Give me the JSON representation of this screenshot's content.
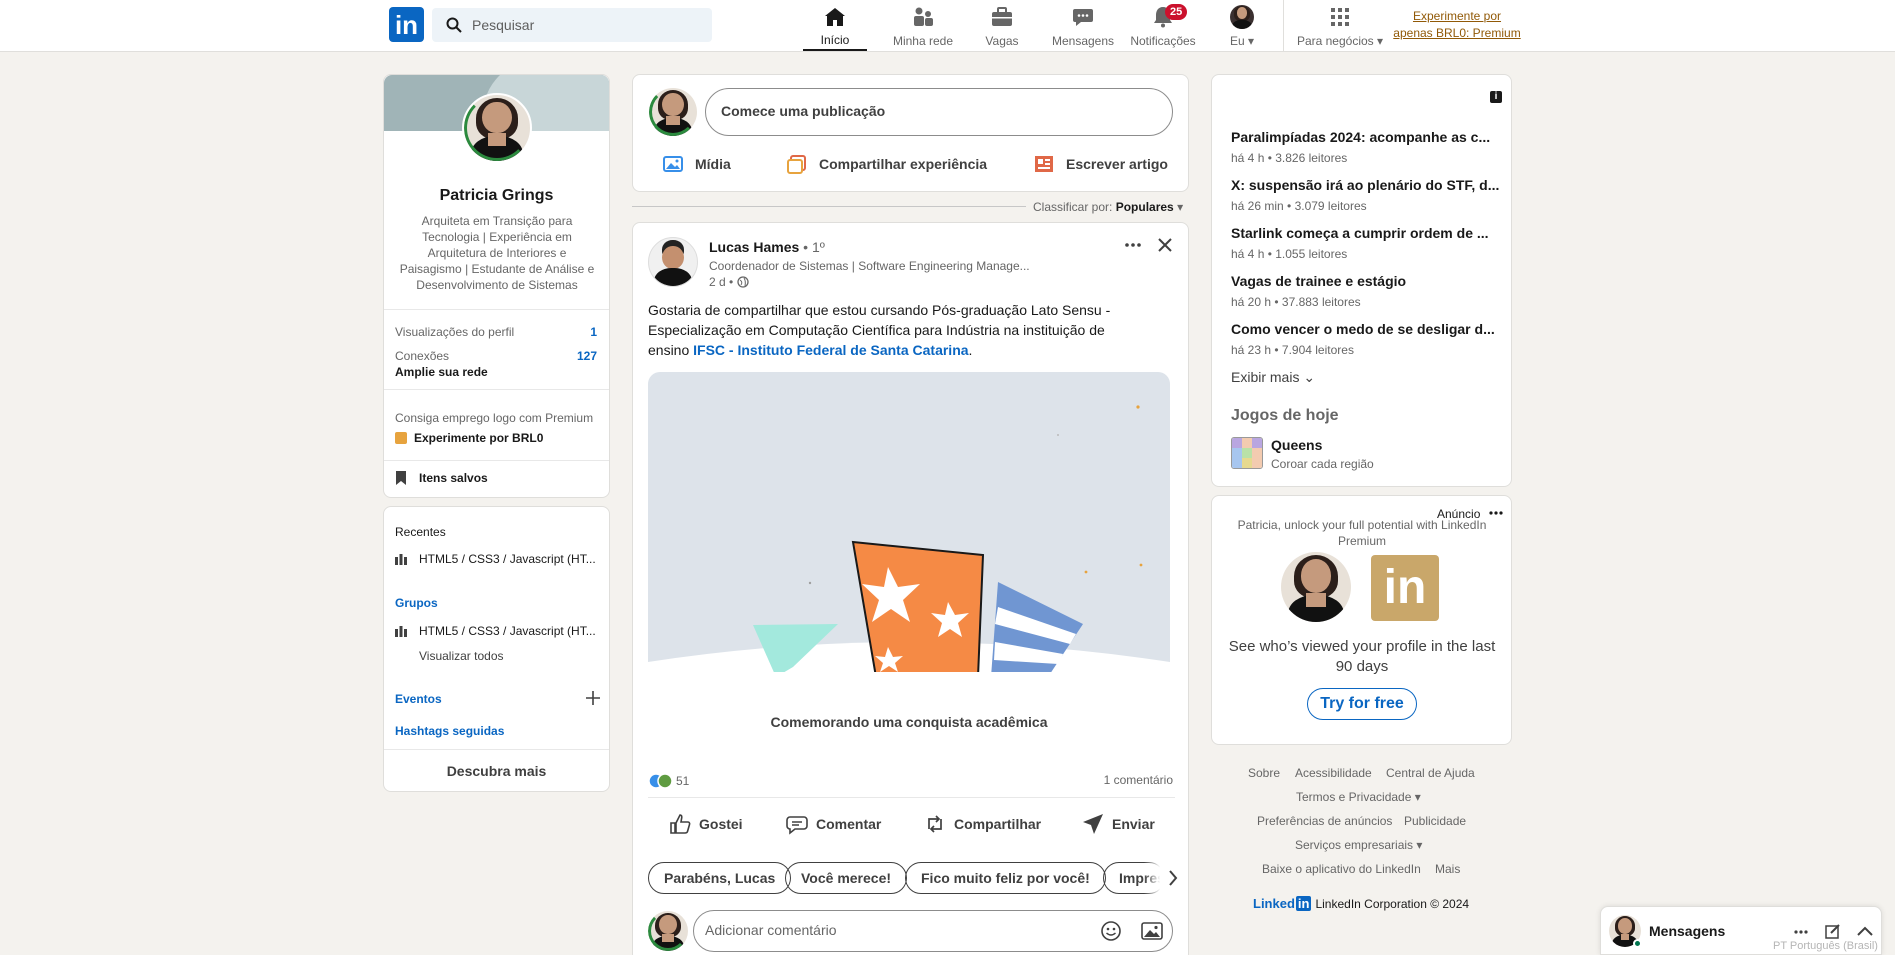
{
  "header": {
    "search_placeholder": "Pesquisar",
    "nav": [
      {
        "label": "Início",
        "icon": "home-icon"
      },
      {
        "label": "Minha rede",
        "icon": "network-icon"
      },
      {
        "label": "Vagas",
        "icon": "briefcase-icon"
      },
      {
        "label": "Mensagens",
        "icon": "messaging-icon"
      },
      {
        "label": "Notificações",
        "icon": "bell-icon",
        "badge": "25"
      },
      {
        "label": "Eu",
        "icon": "avatar"
      },
      {
        "label": "Para negócios",
        "icon": "grid-icon"
      }
    ],
    "premium_cta": "Experimente por apenas BRL0: Premium"
  },
  "profile": {
    "name": "Patricia Grings",
    "headline": "Arquiteta em Transição para Tecnologia | Experiência em Arquitetura de Interiores e Paisagismo | Estudante de Análise e Desenvolvimento de Sistemas",
    "profile_views_label": "Visualizações do perfil",
    "profile_views_value": "1",
    "connections_label": "Conexões",
    "connections_value": "127",
    "grow_network": "Amplie sua rede",
    "premium_teaser": "Consiga emprego logo com Premium",
    "premium_try": "Experimente por BRL0",
    "saved_items": "Itens salvos"
  },
  "left_secondary": {
    "recent_title": "Recentes",
    "recent_item": "HTML5 / CSS3 / Javascript (HT...",
    "groups_title": "Grupos",
    "group_item": "HTML5 / CSS3 / Javascript (HT...",
    "view_all": "Visualizar todos",
    "events": "Eventos",
    "hashtags": "Hashtags seguidas",
    "discover": "Descubra mais"
  },
  "composer": {
    "placeholder": "Comece uma publicação",
    "media": "Mídia",
    "share_experience": "Compartilhar experiência",
    "write_article": "Escrever artigo"
  },
  "sort": {
    "label": "Classificar por:",
    "value": "Populares"
  },
  "post": {
    "author": "Lucas Hames",
    "degree": "• 1º",
    "subtitle": "Coordenador de Sistemas | Software Engineering Manage...",
    "time": "2 d •",
    "text": "Gostaria de compartilhar que estou cursando Pós-graduação Lato Sensu - Especialização em Computação Científica para Indústria na instituição de ensino",
    "link": "IFSC - Instituto Federal de Santa Catarina",
    "link_suffix": ".",
    "caption": "Comemorando uma conquista acadêmica",
    "reactions": "51",
    "comments": "1 comentário",
    "actions": [
      "Gostei",
      "Comentar",
      "Compartilhar",
      "Enviar"
    ],
    "suggestions": [
      "Parabéns, Lucas",
      "Você merece!",
      "Fico muito feliz por você!",
      "Impres"
    ],
    "comment_placeholder": "Adicionar comentário"
  },
  "news": {
    "items": [
      {
        "title": "Paralimpíadas 2024: acompanhe as c...",
        "meta": "há 4 h • 3.826 leitores"
      },
      {
        "title": "X: suspensão irá ao plenário do STF, d...",
        "meta": "há 26 min • 3.079 leitores"
      },
      {
        "title": "Starlink começa a cumprir ordem de ...",
        "meta": "há 4 h • 1.055 leitores"
      },
      {
        "title": "Vagas de trainee e estágio",
        "meta": "há 20 h • 37.883 leitores"
      },
      {
        "title": "Como vencer o medo de se desligar d...",
        "meta": "há 23 h • 7.904 leitores"
      }
    ],
    "show_more": "Exibir mais",
    "games_title": "Jogos de hoje",
    "game_name": "Queens",
    "game_desc": "Coroar cada região"
  },
  "ad": {
    "label": "Anúncio",
    "intro": "Patricia, unlock your full potential with LinkedIn Premium",
    "pitch": "See who’s viewed your profile in the last 90 days",
    "cta": "Try for free"
  },
  "footer": {
    "links_row1": [
      "Sobre",
      "Acessibilidade",
      "Central de Ajuda"
    ],
    "links_row2": [
      "Termos e Privacidade"
    ],
    "links_row3": [
      "Preferências de anúncios",
      "Publicidade"
    ],
    "links_row4": [
      "Serviços empresariais"
    ],
    "links_row5": [
      "Baixe o aplicativo do LinkedIn",
      "Mais"
    ],
    "brand": "Linked",
    "copyright": "LinkedIn Corporation © 2024"
  },
  "messaging": {
    "title": "Mensagens",
    "language": "PT Português (Brasil)"
  },
  "colors": {
    "brand": "#0a66c2",
    "background": "#f4f2ee",
    "badge": "#cb112d",
    "premium": "#915907"
  }
}
